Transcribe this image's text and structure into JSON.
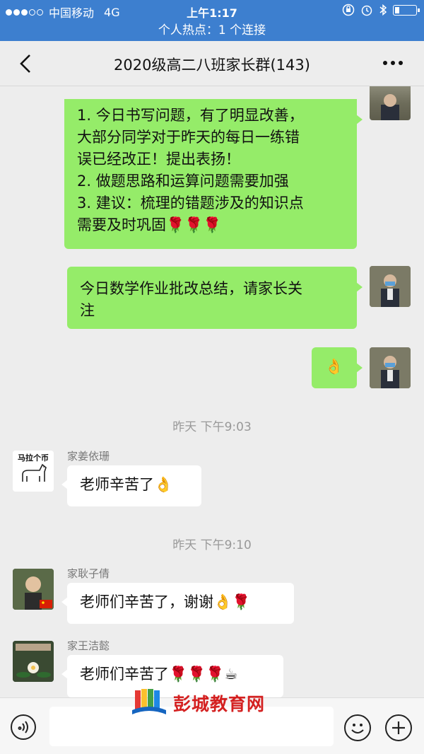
{
  "status_bar": {
    "carrier": "中国移动",
    "network": "4G",
    "time": "上午1:17"
  },
  "hotspot_banner": "个人热点：1 个连接",
  "nav": {
    "title": "2020级高二八班家长群(143)"
  },
  "messages": {
    "m1_lines": [
      "1. 今日书写问题，有了明显改善，",
      "大部分同学对于昨天的每日一练错",
      "误已经改正！提出表扬！",
      "2. 做题思路和运算问题需要加强",
      "3. 建议：梳理的错题涉及的知识点",
      "需要及时巩固🌹🌹🌹"
    ],
    "m2_lines": [
      "今日数学作业批改总结，请家长关",
      "注"
    ],
    "m3_text": "👌",
    "time1": "昨天  下午9:03",
    "m4_sender": "家姜依珊",
    "m4_text": "老师辛苦了👌",
    "m4_avatar_text": "马拉个币",
    "time2": "昨天  下午9:10",
    "m5_sender": "家耿子倩",
    "m5_text": "老师们辛苦了，谢谢👌🌹",
    "m6_sender": "家王洁懿",
    "m6_text": "老师们辛苦了🌹🌹🌹☕"
  },
  "watermark": {
    "text": "彭城教育网"
  },
  "colors": {
    "bar_blue": "#3d7fcf",
    "outgoing_bubble": "#95ec69",
    "incoming_bubble": "#ffffff",
    "watermark_red": "#d42020"
  }
}
